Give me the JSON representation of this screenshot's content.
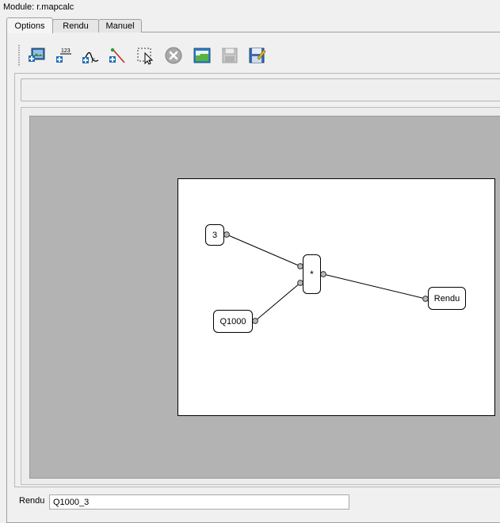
{
  "module": {
    "title": "Module: r.mapcalc"
  },
  "tabs": [
    {
      "label": "Options",
      "active": true
    },
    {
      "label": "Rendu",
      "active": false
    },
    {
      "label": "Manuel",
      "active": false
    }
  ],
  "toolbar": {
    "items": [
      {
        "icon": "add-raster-map-icon"
      },
      {
        "icon": "add-constant-icon"
      },
      {
        "icon": "add-function-icon"
      },
      {
        "icon": "add-relation-icon"
      },
      {
        "icon": "select-tool-icon"
      },
      {
        "icon": "delete-icon"
      },
      {
        "icon": "open-file-icon"
      },
      {
        "icon": "save-icon"
      },
      {
        "icon": "save-as-icon"
      }
    ]
  },
  "description": {
    "text": ""
  },
  "model": {
    "nodes": {
      "constant": "3",
      "operator": "*",
      "input_map": "Q1000",
      "output": "Rendu"
    }
  },
  "output": {
    "label": "Rendu",
    "value": "Q1000_3"
  }
}
